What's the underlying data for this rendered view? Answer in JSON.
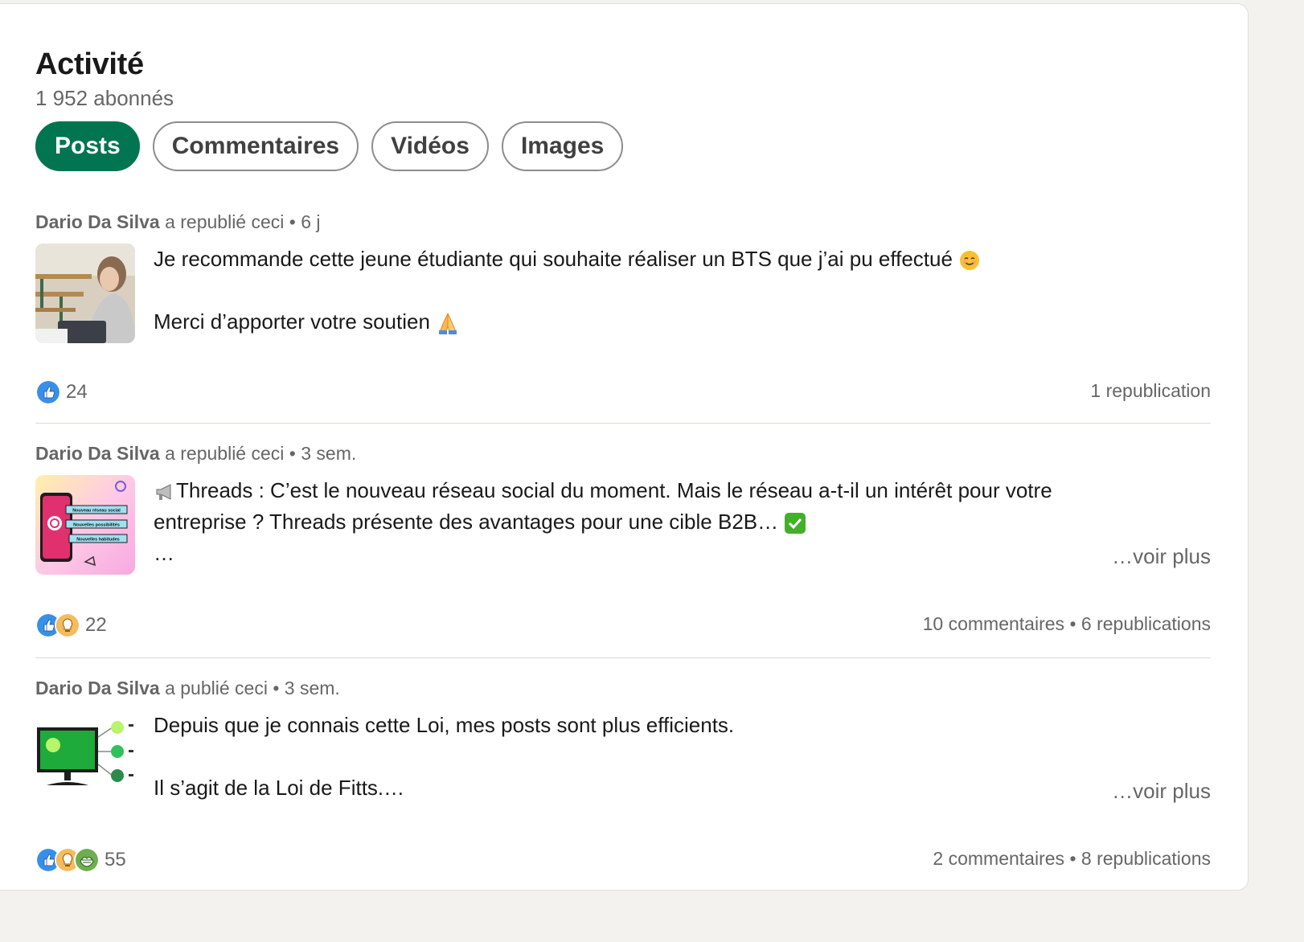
{
  "section": {
    "title": "Activité",
    "followers": "1 952 abonnés"
  },
  "tabs": [
    {
      "label": "Posts",
      "active": true
    },
    {
      "label": "Commentaires",
      "active": false
    },
    {
      "label": "Vidéos",
      "active": false
    },
    {
      "label": "Images",
      "active": false
    }
  ],
  "posts": [
    {
      "author": "Dario Da Silva",
      "action": "a republié ceci",
      "time": "6 j",
      "line1": "Je recommande cette jeune étudiante qui souhaite réaliser un BTS que j’ai pu effectué",
      "line2": "Merci d’apporter votre soutien",
      "reaction_count": "24",
      "reaction_icons": [
        "like-icon"
      ],
      "stats": "1 republication"
    },
    {
      "author": "Dario Da Silva",
      "action": "a republié ceci",
      "time": "3 sem.",
      "line1": "Threads : C’est le nouveau réseau social du moment. Mais le réseau a-t-il un intérêt pour votre",
      "line2": "entreprise ? Threads présente des avantages pour une cible B2B…",
      "line3": "…",
      "see_more": "…voir plus",
      "thumb_labels": [
        "Nouveau réseau social",
        "Nouvelles possibilités",
        "Nouvelles habitudes"
      ],
      "reaction_count": "22",
      "reaction_icons": [
        "like-icon",
        "insightful-icon"
      ],
      "comments": "10 commentaires",
      "reposts": "6 republications"
    },
    {
      "author": "Dario Da Silva",
      "action": "a publié ceci",
      "time": "3 sem.",
      "line1": "Depuis que je connais cette Loi, mes posts sont plus efficients.",
      "line2": "Il s’agit de la Loi de Fitts.…",
      "see_more": "…voir plus",
      "reaction_count": "55",
      "reaction_icons": [
        "like-icon",
        "insightful-icon",
        "support-icon"
      ],
      "comments": "2 commentaires",
      "reposts": "8 republications"
    }
  ],
  "separator": "•",
  "colors": {
    "accent": "#01754f",
    "like": "#378fe9",
    "insightful": "#f5bb5c",
    "support": "#6dae4f"
  }
}
